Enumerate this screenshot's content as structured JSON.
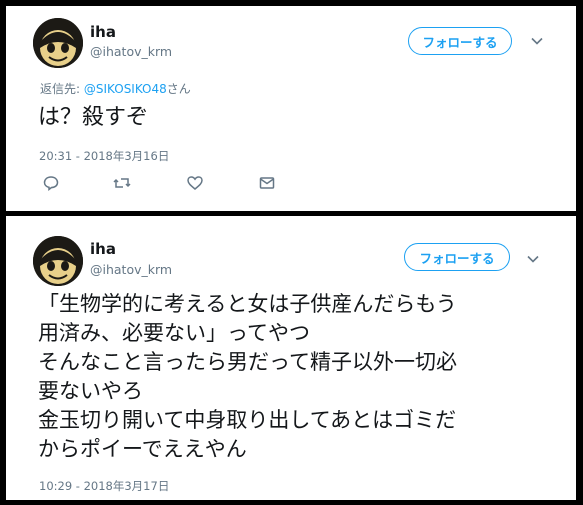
{
  "tweets": [
    {
      "name": "iha",
      "handle": "@ihatov_krm",
      "follow_label": "フォローする",
      "reply_prefix": "返信先:",
      "reply_mention": "@SIKOSIKO48",
      "reply_suffix": "さん",
      "lines": [
        "は？殺すぞ"
      ],
      "timestamp": "20:31 - 2018年3月16日",
      "actions": [
        "reply-icon",
        "retweet-icon",
        "like-icon",
        "message-icon"
      ]
    },
    {
      "name": "iha",
      "handle": "@ihatov_krm",
      "follow_label": "フォローする",
      "lines": [
        "「生物学的に考えると女は子供産んだらもう",
        "用済み、必要ない」ってやつ",
        "そんなこと言ったら男だって精子以外一切必",
        "要ないやろ",
        "金玉切り開いて中身取り出してあとはゴミだ",
        "からポイーでええやん"
      ],
      "timestamp": "10:29 - 2018年3月17日"
    }
  ],
  "colors": {
    "accent": "#1da1f2",
    "text": "#14171a",
    "muted": "#657786",
    "frame": "#000000"
  }
}
